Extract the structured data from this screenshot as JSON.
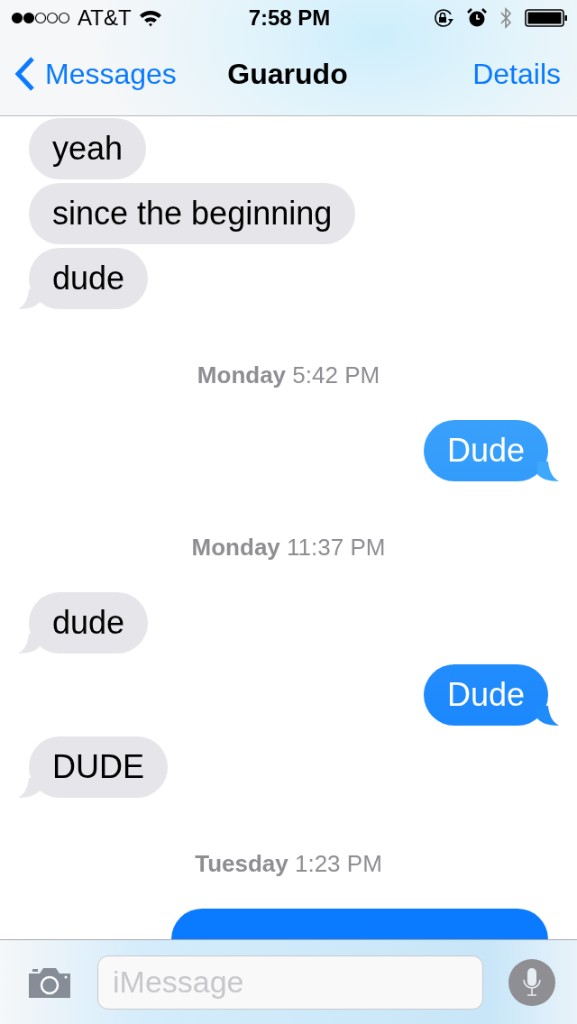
{
  "status_bar": {
    "carrier": "AT&T",
    "time": "7:58 PM"
  },
  "nav": {
    "back": "Messages",
    "title": "Guarudo",
    "action": "Details"
  },
  "messages": [
    {
      "kind": "incoming",
      "text": "yeah",
      "tail": false
    },
    {
      "kind": "incoming",
      "text": "since the beginning",
      "tail": false
    },
    {
      "kind": "incoming",
      "text": "dude",
      "tail": true
    },
    {
      "kind": "timestamp",
      "text": "**Monday** 5:42 PM"
    },
    {
      "kind": "outgoing",
      "text": "Dude",
      "tail": true
    },
    {
      "kind": "timestamp",
      "text": "**Monday** 11:37 PM"
    },
    {
      "kind": "incoming",
      "text": "dude",
      "tail": true
    },
    {
      "kind": "outgoing",
      "text": "Dude",
      "tail": true
    },
    {
      "kind": "incoming",
      "text": "DUDE",
      "tail": true
    },
    {
      "kind": "timestamp",
      "text": "**Tuesday** 1:23 PM"
    },
    {
      "kind": "outgoing"
    }
  ],
  "composer": {
    "placeholder": "iMessage"
  }
}
